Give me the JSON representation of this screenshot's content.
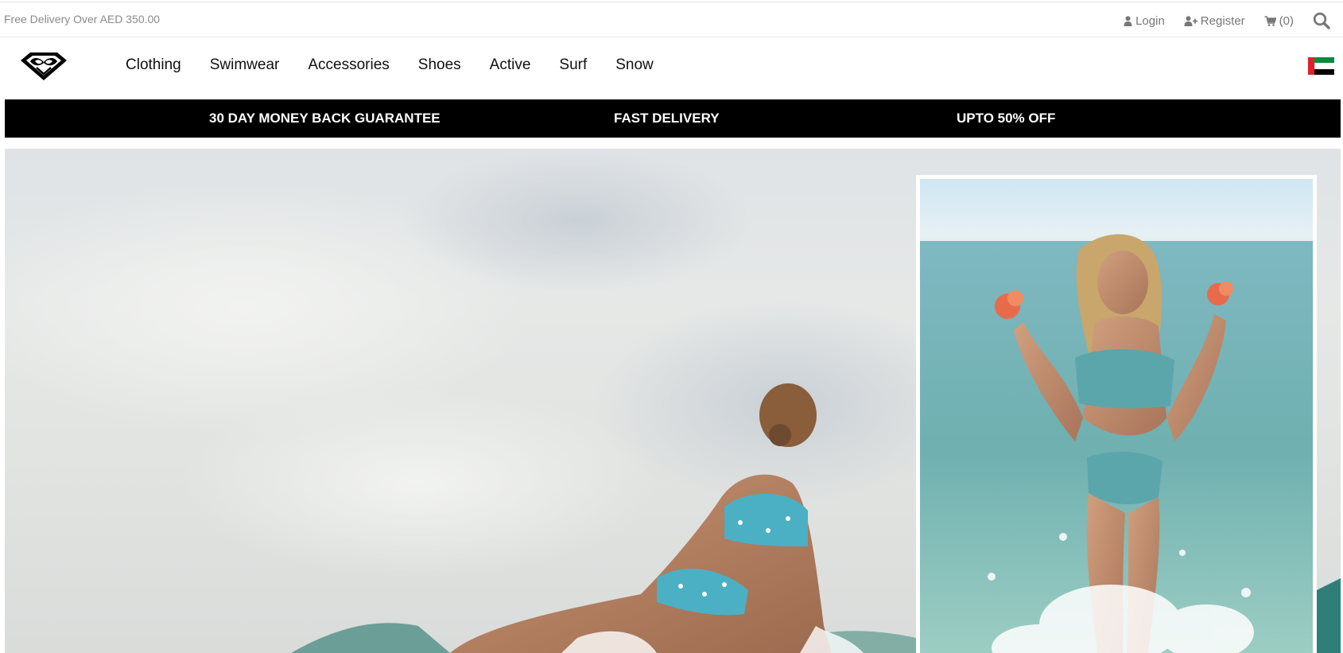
{
  "utility": {
    "promo": "Free Delivery Over AED 350.00",
    "login": "Login",
    "register": "Register",
    "cart": "(0)"
  },
  "nav": {
    "items": [
      "Clothing",
      "Swimwear",
      "Accessories",
      "Shoes",
      "Active",
      "Surf",
      "Snow"
    ]
  },
  "usp": {
    "items": [
      "30 DAY MONEY BACK GUARANTEE",
      "FAST DELIVERY",
      "UPTO 50% OFF"
    ]
  },
  "icons": {
    "logo": "heart-logo-icon",
    "login": "user-icon",
    "register": "user-plus-icon",
    "cart": "cart-icon",
    "search": "search-icon",
    "flag": "uae-flag-icon"
  },
  "colors": {
    "usp_background": "#000000",
    "usp_text": "#ffffff",
    "utility_text": "#777777",
    "flag_red": "#e0202a",
    "flag_green": "#0a8a3a",
    "flag_black": "#000000"
  }
}
